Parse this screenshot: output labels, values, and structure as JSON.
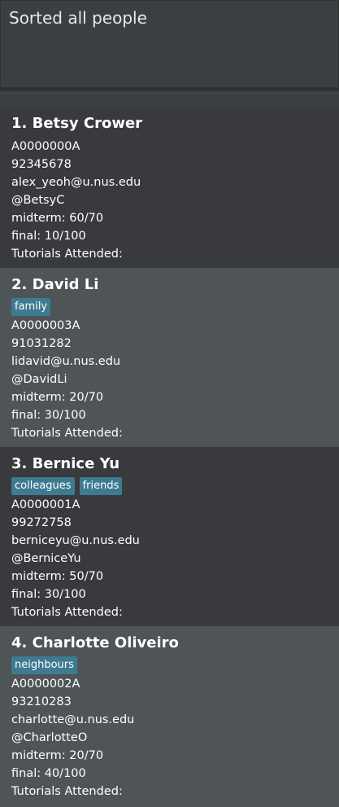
{
  "result": {
    "text": "Sorted all people"
  },
  "persons": [
    {
      "index_name": "1. Betsy Crower",
      "tags": [],
      "student_id": "A0000000A",
      "phone": "92345678",
      "email": "alex_yeoh@u.nus.edu",
      "telegram": "@BetsyC",
      "midterm": "midterm: 60/70",
      "final": "final: 10/100",
      "tutorials": "Tutorials Attended:"
    },
    {
      "index_name": "2. David Li",
      "tags": [
        "family"
      ],
      "student_id": "A0000003A",
      "phone": "91031282",
      "email": "lidavid@u.nus.edu",
      "telegram": "@DavidLi",
      "midterm": "midterm: 20/70",
      "final": "final: 30/100",
      "tutorials": "Tutorials Attended:"
    },
    {
      "index_name": "3. Bernice Yu",
      "tags": [
        "colleagues",
        "friends"
      ],
      "student_id": "A0000001A",
      "phone": "99272758",
      "email": "berniceyu@u.nus.edu",
      "telegram": "@BerniceYu",
      "midterm": "midterm: 50/70",
      "final": "final: 30/100",
      "tutorials": "Tutorials Attended:"
    },
    {
      "index_name": "4. Charlotte Oliveiro",
      "tags": [
        "neighbours"
      ],
      "student_id": "A0000002A",
      "phone": "93210283",
      "email": "charlotte@u.nus.edu",
      "telegram": "@CharlotteO",
      "midterm": "midterm: 20/70",
      "final": "final: 40/100",
      "tutorials": "Tutorials Attended:"
    }
  ],
  "colors": {
    "card_odd": "#383a3d",
    "card_even": "#4f5456",
    "tag_background": "#3e7b91",
    "background": "#3c3f41"
  }
}
